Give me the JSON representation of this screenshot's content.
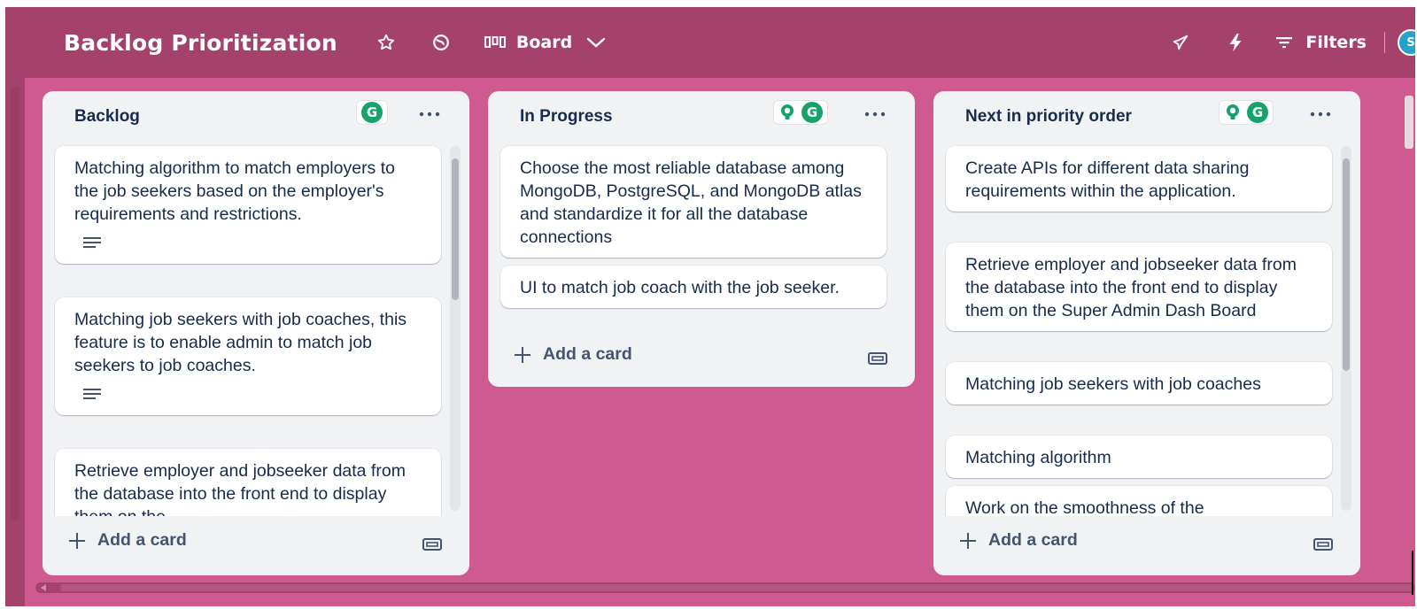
{
  "header": {
    "board_title": "Backlog Prioritization",
    "view_label": "Board",
    "filters_label": "Filters",
    "avatar_initial": "S"
  },
  "lists": [
    {
      "title": "Backlog",
      "badges": [
        "grammarly"
      ],
      "cards": [
        {
          "text": "Matching algorithm to match employers to the job seekers based on the employer's requirements and restrictions.",
          "has_description": true
        },
        {
          "text": "Matching job seekers with job coaches, this feature is to enable admin to match job seekers to job coaches.",
          "has_description": true
        },
        {
          "text": "Retrieve employer and jobseeker data from the database into the front end to display them on the",
          "has_description": false
        }
      ],
      "add_card_label": "Add a card"
    },
    {
      "title": "In Progress",
      "badges": [
        "lightbulb",
        "grammarly"
      ],
      "cards": [
        {
          "text": "Choose the most reliable database among MongoDB, PostgreSQL, and MongoDB atlas and standardize it for all the database connections",
          "has_description": false
        },
        {
          "text": "UI to match job coach with the job seeker.",
          "has_description": false
        }
      ],
      "add_card_label": "Add a card"
    },
    {
      "title": "Next in priority order",
      "badges": [
        "lightbulb",
        "grammarly"
      ],
      "cards": [
        {
          "text": "Create APIs for different data sharing requirements within the application.",
          "has_description": false
        },
        {
          "text": "Retrieve employer and jobseeker data from the database into the front end to display them on the Super Admin Dash Board",
          "has_description": false
        },
        {
          "text": "Matching job seekers with job coaches",
          "has_description": false
        },
        {
          "text": "Matching algorithm",
          "has_description": false
        },
        {
          "text": "Work on the smoothness of the",
          "has_description": false
        }
      ],
      "add_card_label": "Add a card"
    }
  ],
  "icons": {
    "star": "star-icon",
    "globe": "globe-icon",
    "board_view": "board-view-icon",
    "chevron": "chevron-down-icon",
    "rocket": "rocket-icon",
    "bolt": "lightning-bolt-icon",
    "filter": "filter-icon",
    "more": "more-horizontal-icon",
    "plus": "plus-icon",
    "template": "card-template-icon",
    "description": "description-lines-icon",
    "grammarly": "grammarly-icon",
    "lightbulb": "lightbulb-icon"
  },
  "colors": {
    "board_background": "#cf5a8f",
    "header_background": "#a5426b",
    "list_background": "#f1f2f4",
    "card_background": "#ffffff",
    "text_primary": "#172b4d",
    "grammarly_green": "#15a36a",
    "avatar_blue": "#27a2c9"
  }
}
